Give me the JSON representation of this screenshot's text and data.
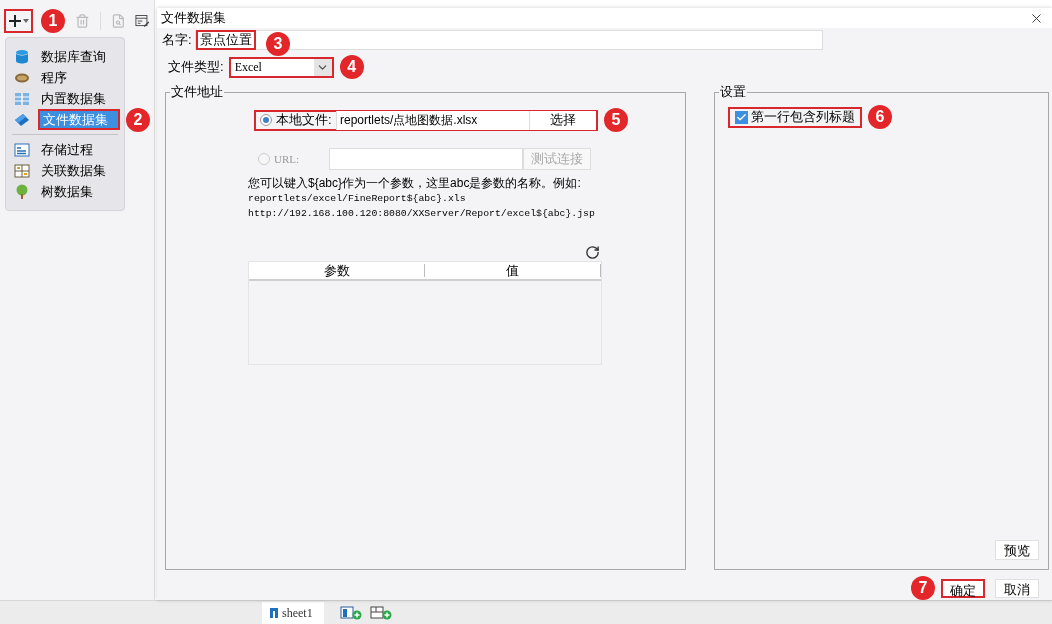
{
  "toolbar": {
    "add_button": {
      "callout": "1"
    }
  },
  "menu": {
    "groups": [
      [
        {
          "kind": "database",
          "label": "数据库查询",
          "selected": false
        },
        {
          "kind": "program",
          "label": "程序",
          "selected": false
        },
        {
          "kind": "builtin",
          "label": "内置数据集",
          "selected": false
        },
        {
          "kind": "file",
          "label": "文件数据集",
          "selected": true,
          "callout": "2"
        }
      ],
      [
        {
          "kind": "procedure",
          "label": "存储过程",
          "selected": false
        },
        {
          "kind": "relation",
          "label": "关联数据集",
          "selected": false
        },
        {
          "kind": "tree",
          "label": "树数据集",
          "selected": false
        }
      ]
    ]
  },
  "dialog": {
    "title": "文件数据集",
    "name": {
      "label": "名字:",
      "value": "景点位置",
      "callout": "3"
    },
    "file_type": {
      "label": "文件类型:",
      "value": "Excel",
      "callout": "4"
    },
    "file_address": {
      "title": "文件地址",
      "local": {
        "label": "本地文件:",
        "selected": true,
        "value": "reportlets/点地图数据.xlsx",
        "button": "选择",
        "callout": "5"
      },
      "url": {
        "label": "URL:",
        "selected": false,
        "disabled": true,
        "button": "测试连接"
      },
      "hint": [
        "您可以键入${abc}作为一个参数，这里abc是参数的名称。例如:",
        "reportlets/excel/FineReport${abc}.xls",
        "http://192.168.100.120:8080/XXServer/Report/excel${abc}.jsp"
      ],
      "params_table": {
        "columns": [
          "参数",
          "值"
        ]
      }
    },
    "settings": {
      "title": "设置",
      "first_row_header": {
        "label": "第一行包含列标题",
        "checked": true,
        "callout": "6"
      },
      "preview_button": "预览"
    },
    "buttons": [
      {
        "label": "确定",
        "callout": "7"
      },
      {
        "label": "取消"
      }
    ]
  },
  "sheet_tabs": [
    {
      "label": "sheet1"
    }
  ]
}
